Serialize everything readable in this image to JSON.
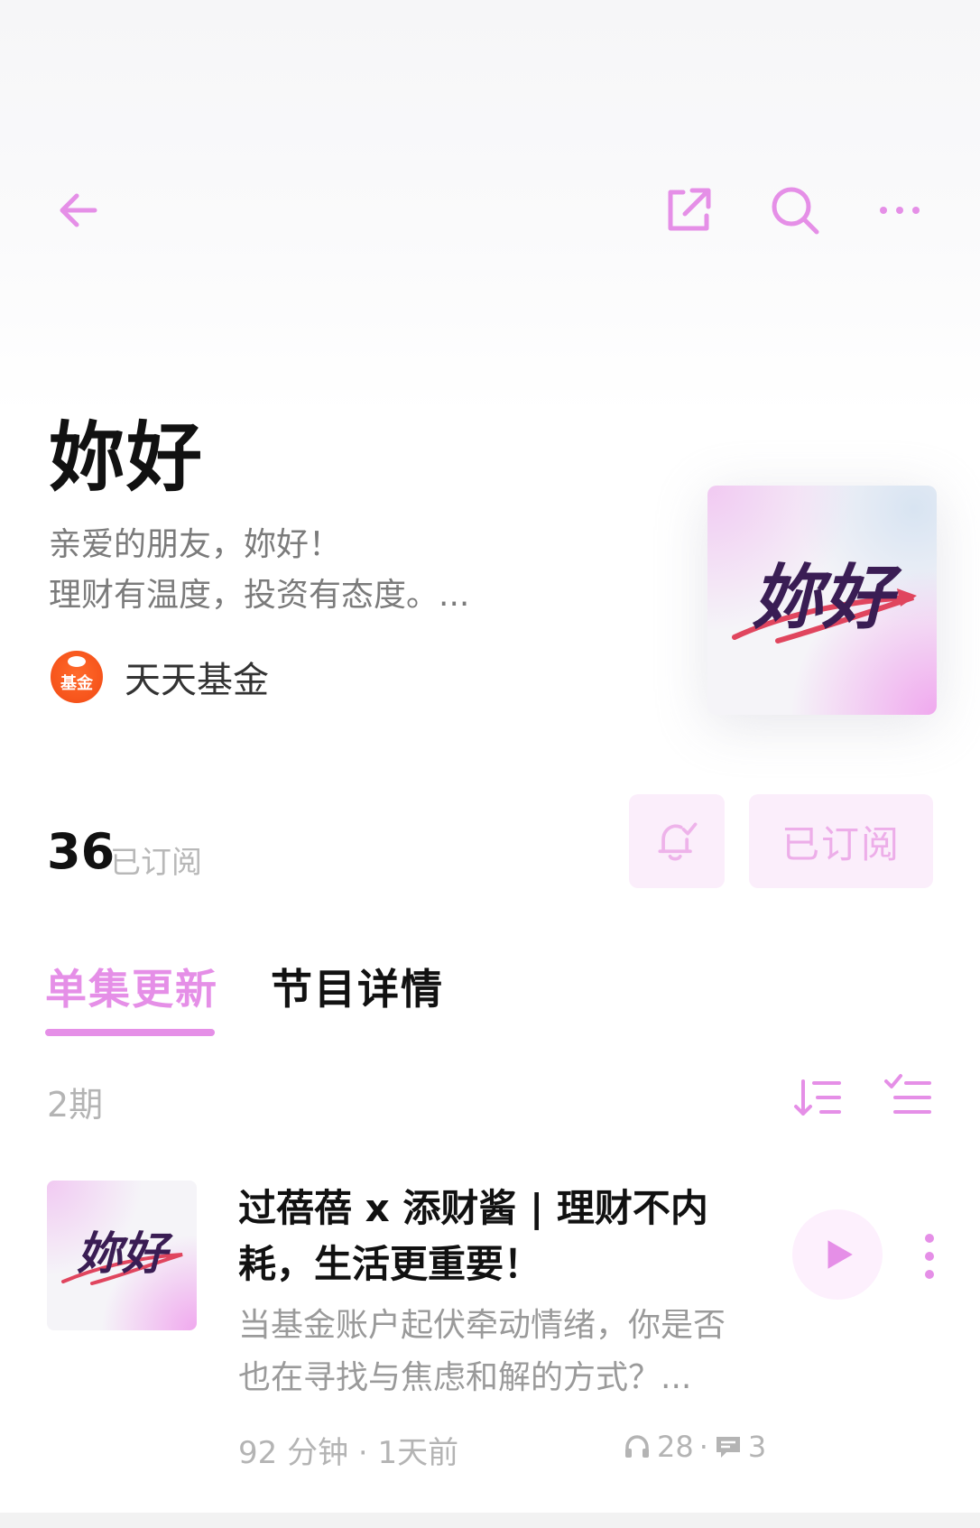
{
  "header": {
    "title": "妳好",
    "description_line1": "亲爱的朋友，妳好！",
    "description_line2": "理财有温度，投资有态度。...",
    "author_name": "天天基金",
    "author_avatar_text": "基金",
    "cover_text": "妳好"
  },
  "toolbar": {
    "back_icon": "arrow-left-icon",
    "share_icon": "external-share-icon",
    "search_icon": "search-icon",
    "more_icon": "more-horizontal-icon"
  },
  "subscription": {
    "count": "36",
    "count_label": "已订阅",
    "button_label": "已订阅",
    "bell_icon": "bell-check-icon"
  },
  "tabs": [
    {
      "label": "单集更新",
      "active": true
    },
    {
      "label": "节目详情",
      "active": false
    }
  ],
  "episodes_header": {
    "count_label": "2期",
    "sort_icon": "sort-icon",
    "list_icon": "checklist-icon"
  },
  "episodes": [
    {
      "title_line1": "过蓓蓓 x 添财酱 | 理财不内",
      "title_line2": "耗，生活更重要！",
      "desc_line1": "当基金账户起伏牵动情绪，你是否",
      "desc_line2": "也在寻找与焦虑和解的方式？...",
      "meta": "92 分钟 · 1天前",
      "plays": "28",
      "separator": "·",
      "comments": "3",
      "cover_text": "妳好"
    }
  ],
  "colors": {
    "accent": "#e58fe7",
    "accent_light_bg": "#fbeefb",
    "muted_text": "#b4b4b4"
  }
}
